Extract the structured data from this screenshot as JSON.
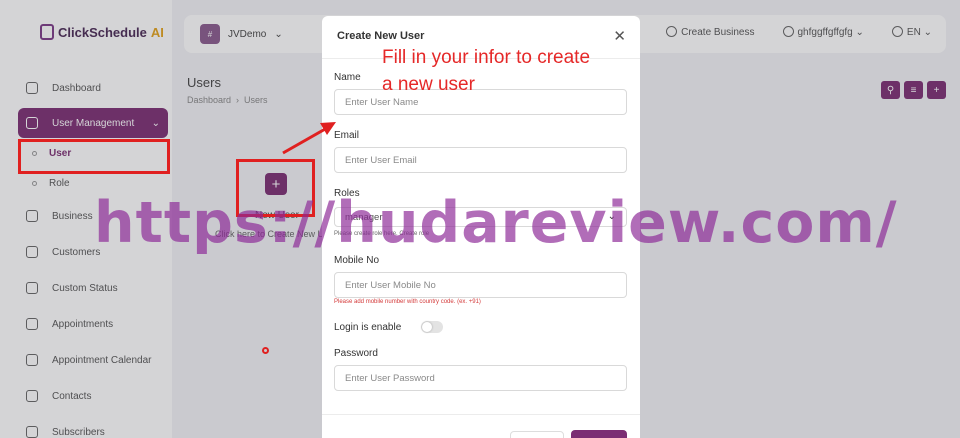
{
  "app": {
    "logo_main": "ClickSchedule",
    "logo_accent": "AI"
  },
  "topbar": {
    "business_avatar": "#",
    "business_name": "JVDemo",
    "create_business": "Create Business",
    "user": "ghfggffgffgfg",
    "language": "EN"
  },
  "sidebar": {
    "items": [
      {
        "label": "Dashboard"
      },
      {
        "label": "User Management"
      },
      {
        "label": "Business"
      },
      {
        "label": "Customers"
      },
      {
        "label": "Custom Status"
      },
      {
        "label": "Appointments"
      },
      {
        "label": "Appointment Calendar"
      },
      {
        "label": "Contacts"
      },
      {
        "label": "Subscribers"
      }
    ],
    "sub_items": [
      {
        "label": "User"
      },
      {
        "label": "Role"
      }
    ]
  },
  "page": {
    "title": "Users",
    "breadcrumb": [
      "Dashboard",
      "Users"
    ],
    "empty_title": "New User",
    "empty_sub": "Click here to Create New User"
  },
  "modal": {
    "title": "Create New User",
    "name_label": "Name",
    "name_placeholder": "Enter User Name",
    "email_label": "Email",
    "email_placeholder": "Enter User Email",
    "roles_label": "Roles",
    "role_value": "manager",
    "roles_hint": "Please create role here.",
    "roles_hint_link": "Create role",
    "mobile_label": "Mobile No",
    "mobile_placeholder": "Enter User Mobile No",
    "mobile_hint": "Please add mobile number with country code. (ex. +91)",
    "login_label": "Login is enable",
    "login_enabled": false,
    "password_label": "Password",
    "password_placeholder": "Enter User Password"
  },
  "annotation": {
    "note_line1": "Fill in your infor to create",
    "note_line2": "a new user",
    "watermark": "https://hudareview.com/"
  },
  "colors": {
    "accent": "#7b2d73",
    "annotation": "#e52828",
    "watermark": "#8c2896"
  }
}
